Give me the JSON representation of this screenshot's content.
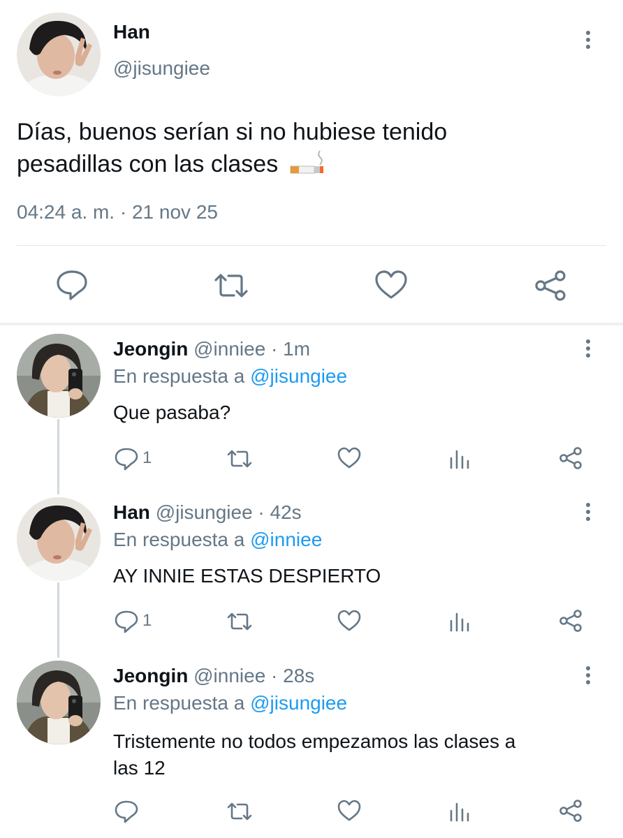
{
  "main_tweet": {
    "name": "Han",
    "handle": "@jisungiee",
    "text": "Días, buenos serían si no hubiese tenido pesadillas con las clases",
    "emoji": "🚬",
    "timestamp": "04:24 a. m. · 21 nov 25"
  },
  "replies": [
    {
      "name": "Jeongin",
      "meta": "@inniee · 1m",
      "reply_prefix": "En respuesta a",
      "reply_to": "@jisungiee",
      "text": "Que pasaba?",
      "reply_count": "1"
    },
    {
      "name": "Han",
      "meta": "@jisungiee · 42s",
      "reply_prefix": "En respuesta a",
      "reply_to": "@inniee",
      "text": "AY INNIE ESTAS DESPIERTO",
      "reply_count": "1"
    },
    {
      "name": "Jeongin",
      "meta": "@inniee · 28s",
      "reply_prefix": "En respuesta a",
      "reply_to": "@jisungiee",
      "text_line1": "Tristemente no todos empezamos las clases a",
      "text_line2": "las 12",
      "reply_count": ""
    }
  ],
  "icons": {
    "reply": "reply-icon",
    "retweet": "retweet-icon",
    "like": "heart-icon",
    "share": "share-icon",
    "views": "views-icon",
    "more": "more-vertical-icon"
  },
  "colors": {
    "text": "#0f1419",
    "muted": "#657786",
    "link": "#1d9bf0"
  }
}
